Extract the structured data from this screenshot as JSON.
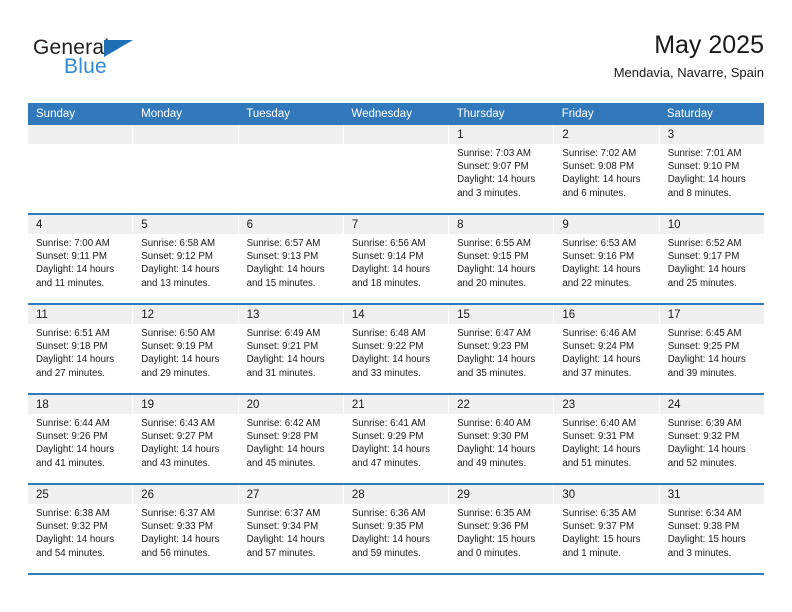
{
  "brand": {
    "name_part1": "General",
    "name_part2": "Blue",
    "triangle_color": "#1f6fb5",
    "blue_color": "#2e8ad4"
  },
  "header": {
    "title": "May 2025",
    "subtitle": "Mendavia, Navarre, Spain"
  },
  "theme": {
    "header_blue": "#3279bb",
    "date_bar_gray": "#f0f0f0",
    "text": "#1a1a1a"
  },
  "weekdays": [
    "Sunday",
    "Monday",
    "Tuesday",
    "Wednesday",
    "Thursday",
    "Friday",
    "Saturday"
  ],
  "weeks": [
    [
      {
        "date": "",
        "lines": []
      },
      {
        "date": "",
        "lines": []
      },
      {
        "date": "",
        "lines": []
      },
      {
        "date": "",
        "lines": []
      },
      {
        "date": "1",
        "lines": [
          "Sunrise: 7:03 AM",
          "Sunset: 9:07 PM",
          "Daylight: 14 hours",
          "and 3 minutes."
        ]
      },
      {
        "date": "2",
        "lines": [
          "Sunrise: 7:02 AM",
          "Sunset: 9:08 PM",
          "Daylight: 14 hours",
          "and 6 minutes."
        ]
      },
      {
        "date": "3",
        "lines": [
          "Sunrise: 7:01 AM",
          "Sunset: 9:10 PM",
          "Daylight: 14 hours",
          "and 8 minutes."
        ]
      }
    ],
    [
      {
        "date": "4",
        "lines": [
          "Sunrise: 7:00 AM",
          "Sunset: 9:11 PM",
          "Daylight: 14 hours",
          "and 11 minutes."
        ]
      },
      {
        "date": "5",
        "lines": [
          "Sunrise: 6:58 AM",
          "Sunset: 9:12 PM",
          "Daylight: 14 hours",
          "and 13 minutes."
        ]
      },
      {
        "date": "6",
        "lines": [
          "Sunrise: 6:57 AM",
          "Sunset: 9:13 PM",
          "Daylight: 14 hours",
          "and 15 minutes."
        ]
      },
      {
        "date": "7",
        "lines": [
          "Sunrise: 6:56 AM",
          "Sunset: 9:14 PM",
          "Daylight: 14 hours",
          "and 18 minutes."
        ]
      },
      {
        "date": "8",
        "lines": [
          "Sunrise: 6:55 AM",
          "Sunset: 9:15 PM",
          "Daylight: 14 hours",
          "and 20 minutes."
        ]
      },
      {
        "date": "9",
        "lines": [
          "Sunrise: 6:53 AM",
          "Sunset: 9:16 PM",
          "Daylight: 14 hours",
          "and 22 minutes."
        ]
      },
      {
        "date": "10",
        "lines": [
          "Sunrise: 6:52 AM",
          "Sunset: 9:17 PM",
          "Daylight: 14 hours",
          "and 25 minutes."
        ]
      }
    ],
    [
      {
        "date": "11",
        "lines": [
          "Sunrise: 6:51 AM",
          "Sunset: 9:18 PM",
          "Daylight: 14 hours",
          "and 27 minutes."
        ]
      },
      {
        "date": "12",
        "lines": [
          "Sunrise: 6:50 AM",
          "Sunset: 9:19 PM",
          "Daylight: 14 hours",
          "and 29 minutes."
        ]
      },
      {
        "date": "13",
        "lines": [
          "Sunrise: 6:49 AM",
          "Sunset: 9:21 PM",
          "Daylight: 14 hours",
          "and 31 minutes."
        ]
      },
      {
        "date": "14",
        "lines": [
          "Sunrise: 6:48 AM",
          "Sunset: 9:22 PM",
          "Daylight: 14 hours",
          "and 33 minutes."
        ]
      },
      {
        "date": "15",
        "lines": [
          "Sunrise: 6:47 AM",
          "Sunset: 9:23 PM",
          "Daylight: 14 hours",
          "and 35 minutes."
        ]
      },
      {
        "date": "16",
        "lines": [
          "Sunrise: 6:46 AM",
          "Sunset: 9:24 PM",
          "Daylight: 14 hours",
          "and 37 minutes."
        ]
      },
      {
        "date": "17",
        "lines": [
          "Sunrise: 6:45 AM",
          "Sunset: 9:25 PM",
          "Daylight: 14 hours",
          "and 39 minutes."
        ]
      }
    ],
    [
      {
        "date": "18",
        "lines": [
          "Sunrise: 6:44 AM",
          "Sunset: 9:26 PM",
          "Daylight: 14 hours",
          "and 41 minutes."
        ]
      },
      {
        "date": "19",
        "lines": [
          "Sunrise: 6:43 AM",
          "Sunset: 9:27 PM",
          "Daylight: 14 hours",
          "and 43 minutes."
        ]
      },
      {
        "date": "20",
        "lines": [
          "Sunrise: 6:42 AM",
          "Sunset: 9:28 PM",
          "Daylight: 14 hours",
          "and 45 minutes."
        ]
      },
      {
        "date": "21",
        "lines": [
          "Sunrise: 6:41 AM",
          "Sunset: 9:29 PM",
          "Daylight: 14 hours",
          "and 47 minutes."
        ]
      },
      {
        "date": "22",
        "lines": [
          "Sunrise: 6:40 AM",
          "Sunset: 9:30 PM",
          "Daylight: 14 hours",
          "and 49 minutes."
        ]
      },
      {
        "date": "23",
        "lines": [
          "Sunrise: 6:40 AM",
          "Sunset: 9:31 PM",
          "Daylight: 14 hours",
          "and 51 minutes."
        ]
      },
      {
        "date": "24",
        "lines": [
          "Sunrise: 6:39 AM",
          "Sunset: 9:32 PM",
          "Daylight: 14 hours",
          "and 52 minutes."
        ]
      }
    ],
    [
      {
        "date": "25",
        "lines": [
          "Sunrise: 6:38 AM",
          "Sunset: 9:32 PM",
          "Daylight: 14 hours",
          "and 54 minutes."
        ]
      },
      {
        "date": "26",
        "lines": [
          "Sunrise: 6:37 AM",
          "Sunset: 9:33 PM",
          "Daylight: 14 hours",
          "and 56 minutes."
        ]
      },
      {
        "date": "27",
        "lines": [
          "Sunrise: 6:37 AM",
          "Sunset: 9:34 PM",
          "Daylight: 14 hours",
          "and 57 minutes."
        ]
      },
      {
        "date": "28",
        "lines": [
          "Sunrise: 6:36 AM",
          "Sunset: 9:35 PM",
          "Daylight: 14 hours",
          "and 59 minutes."
        ]
      },
      {
        "date": "29",
        "lines": [
          "Sunrise: 6:35 AM",
          "Sunset: 9:36 PM",
          "Daylight: 15 hours",
          "and 0 minutes."
        ]
      },
      {
        "date": "30",
        "lines": [
          "Sunrise: 6:35 AM",
          "Sunset: 9:37 PM",
          "Daylight: 15 hours",
          "and 1 minute."
        ]
      },
      {
        "date": "31",
        "lines": [
          "Sunrise: 6:34 AM",
          "Sunset: 9:38 PM",
          "Daylight: 15 hours",
          "and 3 minutes."
        ]
      }
    ]
  ]
}
